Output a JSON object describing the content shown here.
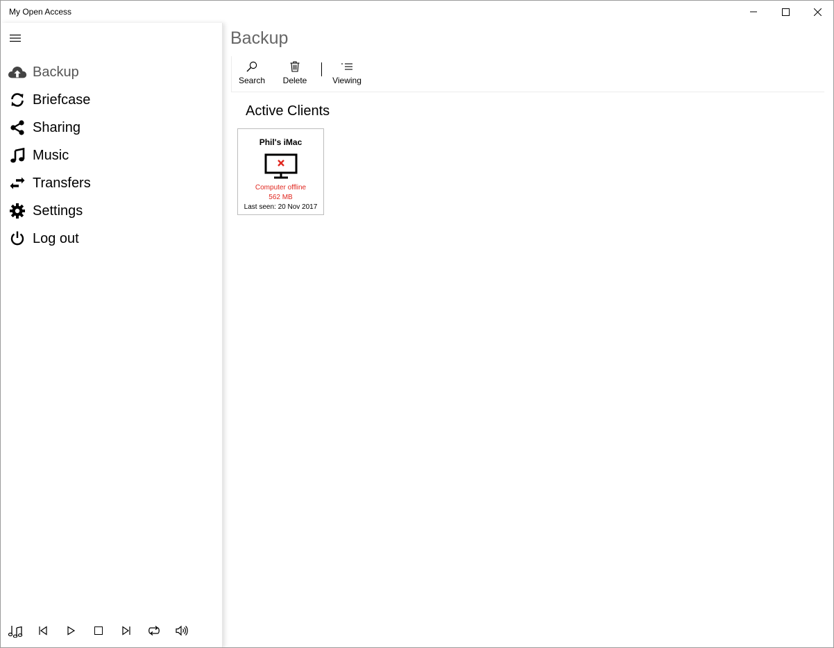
{
  "window": {
    "title": "My Open Access"
  },
  "sidebar": {
    "items": [
      {
        "label": "Backup",
        "icon": "cloud-upload-icon",
        "active": true
      },
      {
        "label": "Briefcase",
        "icon": "sync-icon"
      },
      {
        "label": "Sharing",
        "icon": "share-icon"
      },
      {
        "label": "Music",
        "icon": "music-note-icon"
      },
      {
        "label": "Transfers",
        "icon": "transfer-arrows-icon"
      },
      {
        "label": "Settings",
        "icon": "gear-icon"
      },
      {
        "label": "Log out",
        "icon": "power-icon"
      }
    ],
    "player": [
      "music-library-icon",
      "previous-track-icon",
      "play-icon",
      "stop-icon",
      "next-track-icon",
      "repeat-icon",
      "volume-icon"
    ]
  },
  "main": {
    "title": "Backup",
    "toolbar": {
      "search_label": "Search",
      "delete_label": "Delete",
      "viewing_label": "Viewing"
    },
    "section_title": "Active Clients",
    "clients": [
      {
        "name": "Phil's iMac",
        "status": "Computer offline",
        "size": "562 MB",
        "last_seen": "Last seen: 20 Nov 2017",
        "status_color": "#e0271f"
      }
    ]
  }
}
